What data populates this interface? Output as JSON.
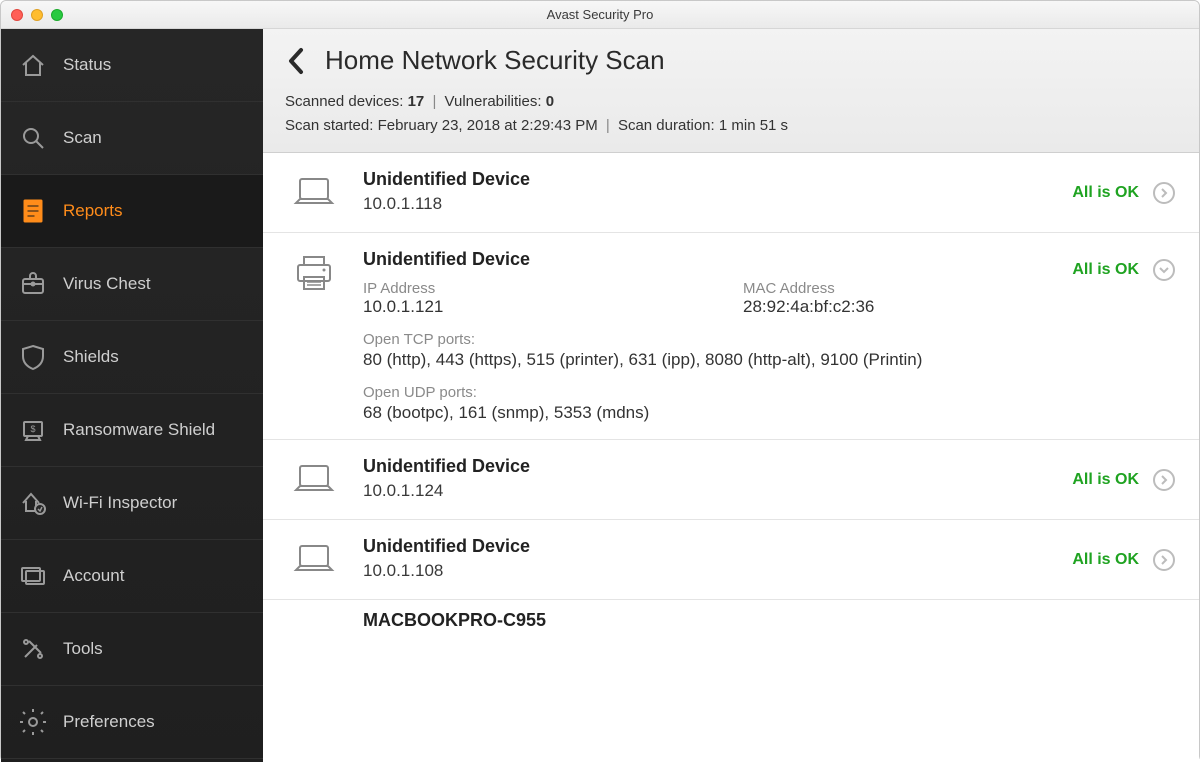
{
  "window": {
    "title": "Avast Security Pro"
  },
  "sidebar": {
    "items": [
      {
        "id": "status",
        "label": "Status"
      },
      {
        "id": "scan",
        "label": "Scan"
      },
      {
        "id": "reports",
        "label": "Reports"
      },
      {
        "id": "virus-chest",
        "label": "Virus Chest"
      },
      {
        "id": "shields",
        "label": "Shields"
      },
      {
        "id": "ransomware-shield",
        "label": "Ransomware Shield"
      },
      {
        "id": "wifi-inspector",
        "label": "Wi-Fi Inspector"
      },
      {
        "id": "account",
        "label": "Account"
      },
      {
        "id": "tools",
        "label": "Tools"
      },
      {
        "id": "preferences",
        "label": "Preferences"
      }
    ],
    "active_index": 2
  },
  "header": {
    "title": "Home Network Security Scan",
    "stats": {
      "scanned_label": "Scanned devices:",
      "scanned_count": "17",
      "vuln_label": "Vulnerabilities:",
      "vuln_count": "0",
      "start_label": "Scan started:",
      "start_value": "February 23, 2018 at 2:29:43 PM",
      "duration_label": "Scan duration:",
      "duration_value": "1 min 51 s"
    }
  },
  "status_text": {
    "ok": "All is OK"
  },
  "field_labels": {
    "ip": "IP Address",
    "mac": "MAC Address",
    "tcp": "Open TCP ports:",
    "udp": "Open UDP ports:"
  },
  "devices": [
    {
      "type": "laptop",
      "name": "Unidentified Device",
      "ip": "10.0.1.118",
      "status": "ok",
      "expanded": false
    },
    {
      "type": "printer",
      "name": "Unidentified Device",
      "ip": "10.0.1.121",
      "mac": "28:92:4a:bf:c2:36",
      "tcp_ports": "80 (http), 443 (https), 515 (printer), 631 (ipp), 8080 (http-alt), 9100 (Printin)",
      "udp_ports": "68 (bootpc), 161 (snmp), 5353 (mdns)",
      "status": "ok",
      "expanded": true
    },
    {
      "type": "laptop",
      "name": "Unidentified Device",
      "ip": "10.0.1.124",
      "status": "ok",
      "expanded": false
    },
    {
      "type": "laptop",
      "name": "Unidentified Device",
      "ip": "10.0.1.108",
      "status": "ok",
      "expanded": false
    }
  ],
  "partial_device_name": "MACBOOKPRO-C955"
}
